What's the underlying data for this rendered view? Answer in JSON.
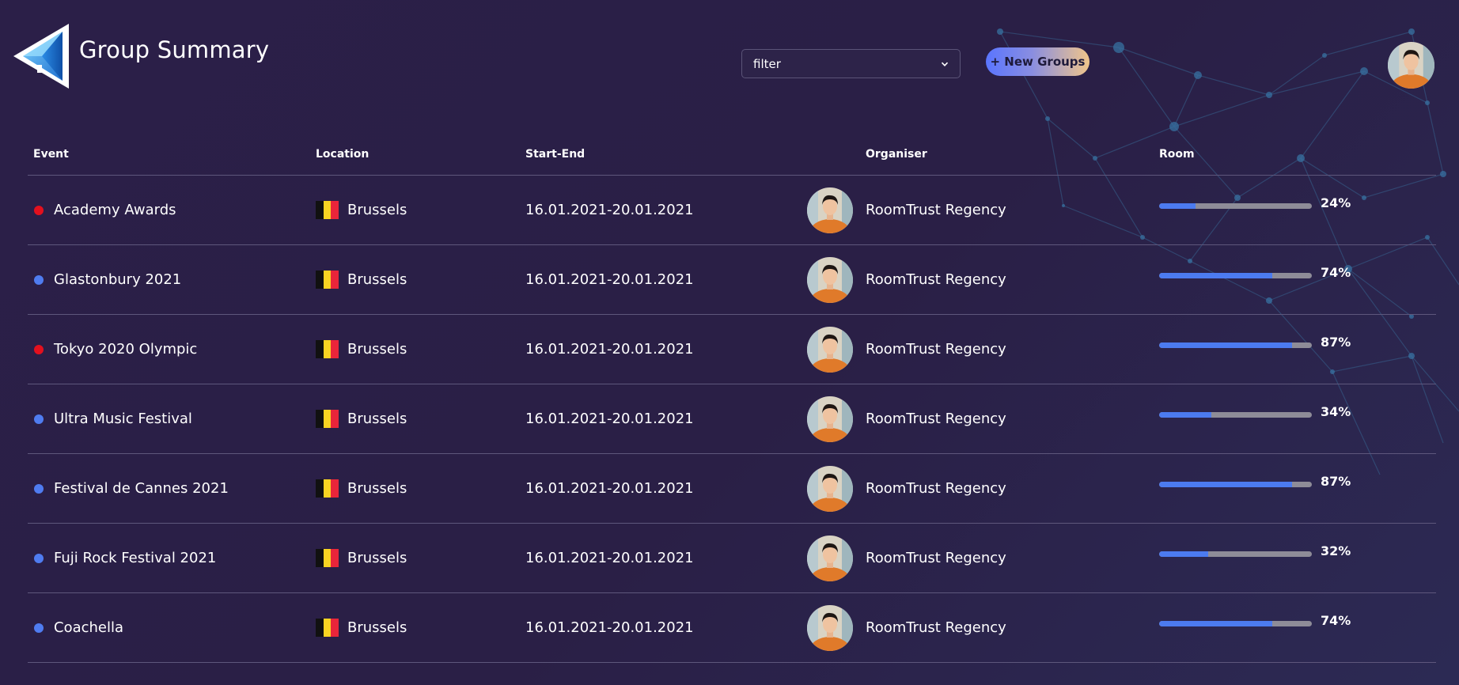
{
  "header": {
    "title": "Group Summary",
    "filter_value": "filter",
    "new_button_label": "+ New Groups"
  },
  "columns": {
    "event": "Event",
    "location": "Location",
    "start_end": "Start-End",
    "organiser": "Organiser",
    "room": "Room"
  },
  "colors": {
    "status_red": "#e3101e",
    "status_blue": "#4f7cf0",
    "progress_fill": "#4c7bf0",
    "progress_track": "#8e8c98",
    "flag_black": "#111111",
    "flag_yellow": "#f8d422",
    "flag_red": "#e9253a"
  },
  "rows": [
    {
      "status": "red",
      "event": "Academy Awards",
      "flag_icon": "belgium-flag-icon",
      "location": "Brussels",
      "dates": "16.01.2021-20.01.2021",
      "organiser": "RoomTrust Regency",
      "room_pct": 24,
      "room_label": "24%"
    },
    {
      "status": "blue",
      "event": "Glastonbury 2021",
      "flag_icon": "belgium-flag-icon",
      "location": "Brussels",
      "dates": "16.01.2021-20.01.2021",
      "organiser": "RoomTrust Regency",
      "room_pct": 74,
      "room_label": "74%"
    },
    {
      "status": "red",
      "event": "Tokyo 2020 Olympic",
      "flag_icon": "belgium-flag-icon",
      "location": "Brussels",
      "dates": "16.01.2021-20.01.2021",
      "organiser": "RoomTrust Regency",
      "room_pct": 87,
      "room_label": "87%"
    },
    {
      "status": "blue",
      "event": "Ultra Music Festival",
      "flag_icon": "belgium-flag-icon",
      "location": "Brussels",
      "dates": "16.01.2021-20.01.2021",
      "organiser": "RoomTrust Regency",
      "room_pct": 34,
      "room_label": "34%"
    },
    {
      "status": "blue",
      "event": "Festival de Cannes 2021",
      "flag_icon": "belgium-flag-icon",
      "location": "Brussels",
      "dates": "16.01.2021-20.01.2021",
      "organiser": "RoomTrust Regency",
      "room_pct": 87,
      "room_label": "87%"
    },
    {
      "status": "blue",
      "event": "Fuji Rock Festival 2021",
      "flag_icon": "belgium-flag-icon",
      "location": "Brussels",
      "dates": "16.01.2021-20.01.2021",
      "organiser": "RoomTrust Regency",
      "room_pct": 32,
      "room_label": "32%"
    },
    {
      "status": "blue",
      "event": "Coachella",
      "flag_icon": "belgium-flag-icon",
      "location": "Brussels",
      "dates": "16.01.2021-20.01.2021",
      "organiser": "RoomTrust Regency",
      "room_pct": 74,
      "room_label": "74%"
    }
  ]
}
